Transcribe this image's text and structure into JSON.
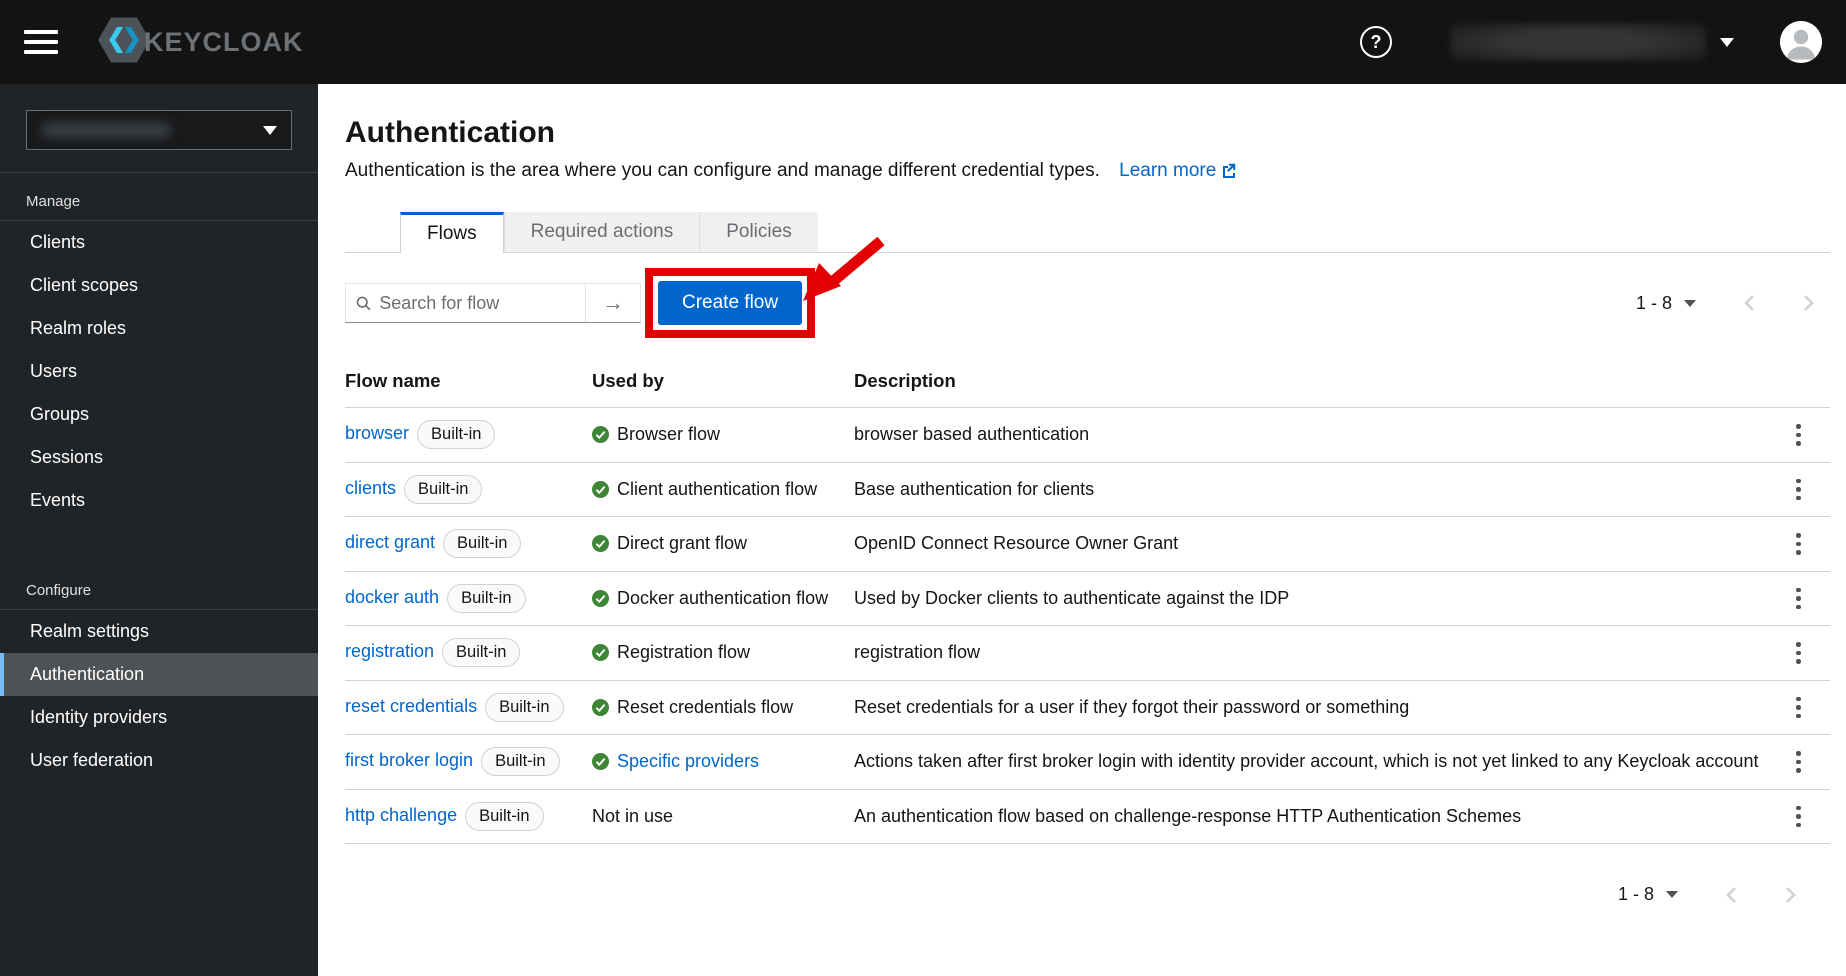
{
  "masthead": {
    "brand": "KEYCLOAK",
    "help_label": "?",
    "username_blurred": "",
    "icons": [
      "hamburger-menu-icon",
      "keycloak-logo",
      "question-circle-icon",
      "caret-down-icon",
      "user-avatar-icon"
    ]
  },
  "sidebar": {
    "realm_selector": {
      "value_blurred": ""
    },
    "sections": [
      {
        "label": "Manage",
        "items": [
          "Clients",
          "Client scopes",
          "Realm roles",
          "Users",
          "Groups",
          "Sessions",
          "Events"
        ],
        "active": ""
      },
      {
        "label": "Configure",
        "items": [
          "Realm settings",
          "Authentication",
          "Identity providers",
          "User federation"
        ],
        "active": "Authentication"
      }
    ]
  },
  "page": {
    "title": "Authentication",
    "description": "Authentication is the area where you can configure and manage different credential types.",
    "learn_more_label": "Learn more",
    "tabs": [
      {
        "label": "Flows",
        "active": true
      },
      {
        "label": "Required actions",
        "active": false
      },
      {
        "label": "Policies",
        "active": false
      }
    ],
    "search_placeholder": "Search for flow",
    "create_button_label": "Create flow",
    "pagination_range": "1 - 8"
  },
  "table": {
    "columns": [
      "Flow name",
      "Used by",
      "Description"
    ],
    "rows": [
      {
        "name": "browser",
        "badge": "Built-in",
        "used_by": "Browser flow",
        "status": "check",
        "used_by_link": false,
        "description": "browser based authentication"
      },
      {
        "name": "clients",
        "badge": "Built-in",
        "used_by": "Client authentication flow",
        "status": "check",
        "used_by_link": false,
        "description": "Base authentication for clients"
      },
      {
        "name": "direct grant",
        "badge": "Built-in",
        "used_by": "Direct grant flow",
        "status": "check",
        "used_by_link": false,
        "description": "OpenID Connect Resource Owner Grant"
      },
      {
        "name": "docker auth",
        "badge": "Built-in",
        "used_by": "Docker authentication flow",
        "status": "check",
        "used_by_link": false,
        "description": "Used by Docker clients to authenticate against the IDP"
      },
      {
        "name": "registration",
        "badge": "Built-in",
        "used_by": "Registration flow",
        "status": "check",
        "used_by_link": false,
        "description": "registration flow"
      },
      {
        "name": "reset credentials",
        "badge": "Built-in",
        "used_by": "Reset credentials flow",
        "status": "check",
        "used_by_link": false,
        "description": "Reset credentials for a user if they forgot their password or something"
      },
      {
        "name": "first broker login",
        "badge": "Built-in",
        "used_by": "Specific providers",
        "status": "check",
        "used_by_link": true,
        "description": "Actions taken after first broker login with identity provider account, which is not yet linked to any Keycloak account"
      },
      {
        "name": "http challenge",
        "badge": "Built-in",
        "used_by": "Not in use",
        "status": "none",
        "used_by_link": false,
        "description": "An authentication flow based on challenge-response HTTP Authentication Schemes"
      }
    ]
  },
  "annotation": {
    "shape": "red-box-and-arrow",
    "target": "Create flow button",
    "color": "#e40000"
  },
  "colors": {
    "accent_blue": "#0066cc",
    "success_green": "#3e8635",
    "masthead_bg": "#131313",
    "sidebar_bg": "#212427",
    "active_nav_border": "#73bcf7"
  }
}
